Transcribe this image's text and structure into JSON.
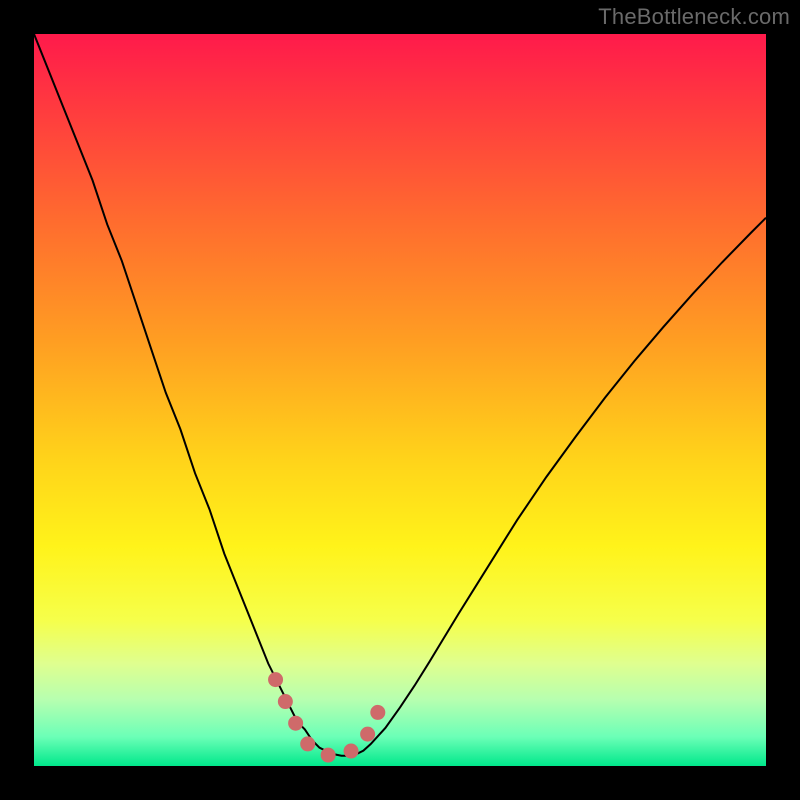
{
  "watermark": "TheBottleneck.com",
  "chart_data": {
    "type": "line",
    "title": "",
    "xlabel": "",
    "ylabel": "",
    "xlim": [
      0,
      100
    ],
    "ylim": [
      0,
      100
    ],
    "grid": false,
    "legend": false,
    "gradient_stops": [
      {
        "offset": 0.0,
        "color": "#ff1a4b"
      },
      {
        "offset": 0.1,
        "color": "#ff3a3f"
      },
      {
        "offset": 0.25,
        "color": "#ff6a2f"
      },
      {
        "offset": 0.42,
        "color": "#ff9e22"
      },
      {
        "offset": 0.58,
        "color": "#ffd31a"
      },
      {
        "offset": 0.7,
        "color": "#fff31a"
      },
      {
        "offset": 0.8,
        "color": "#f6ff4a"
      },
      {
        "offset": 0.86,
        "color": "#dfff8f"
      },
      {
        "offset": 0.91,
        "color": "#b6ffb0"
      },
      {
        "offset": 0.96,
        "color": "#6cffb7"
      },
      {
        "offset": 1.0,
        "color": "#00e88b"
      }
    ],
    "series": [
      {
        "name": "bottleneck-curve",
        "stroke": "#000000",
        "stroke_width": 2.0,
        "x": [
          0,
          2,
          4,
          6,
          8,
          10,
          12,
          14,
          16,
          18,
          20,
          22,
          24,
          26,
          28,
          30,
          32,
          34,
          35,
          36,
          37,
          38,
          39,
          40,
          41,
          42,
          43,
          44,
          45,
          46,
          48,
          50,
          52,
          54,
          56,
          58,
          60,
          63,
          66,
          70,
          74,
          78,
          82,
          86,
          90,
          94,
          98,
          100
        ],
        "y": [
          100,
          95,
          90,
          85,
          80,
          74,
          69,
          63,
          57,
          51,
          46,
          40,
          35,
          29,
          24,
          19,
          14,
          10,
          8,
          6,
          5,
          3.5,
          2.5,
          2,
          1.6,
          1.4,
          1.4,
          1.6,
          2.1,
          3.0,
          5.2,
          8.0,
          11.0,
          14.2,
          17.5,
          20.8,
          24.0,
          28.8,
          33.6,
          39.5,
          45.0,
          50.3,
          55.3,
          60.0,
          64.5,
          68.8,
          72.9,
          74.9
        ]
      },
      {
        "name": "bottleneck-floor-marker",
        "stroke": "#cf6a6a",
        "stroke_width": 15,
        "linecap": "round",
        "dash": "0 24",
        "x": [
          33.0,
          34.7,
          36.2,
          37.4,
          38.8,
          40.6,
          42.6,
          44.2,
          45.5,
          46.6,
          47.8
        ],
        "y": [
          11.8,
          8.0,
          4.9,
          3.0,
          1.8,
          1.4,
          1.6,
          2.6,
          4.2,
          6.4,
          9.4
        ]
      }
    ],
    "flat_interval_x": [
      38,
      45
    ],
    "minimum_x": 41.5,
    "minimum_y": 1.4
  }
}
